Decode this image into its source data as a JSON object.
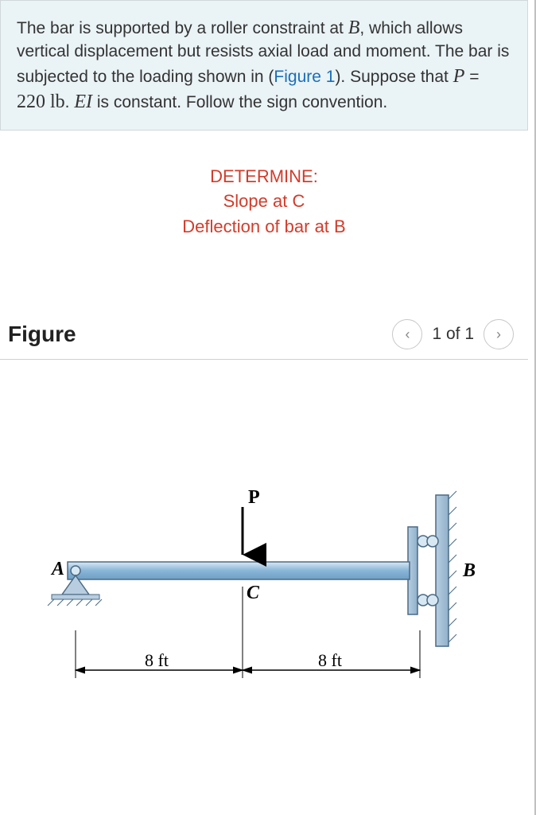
{
  "problem": {
    "text_1": "The bar is supported by a roller constraint at ",
    "var_B": "B",
    "text_2": ", which allows vertical displacement but resists axial load and moment. The bar is subjected to the loading shown in (",
    "fig_link": "Figure 1",
    "text_3": "). Suppose that ",
    "var_P": "P",
    "text_4": " = ",
    "P_value": "220 lb",
    "text_5": ". ",
    "var_EI": "EI",
    "text_6": " is constant. Follow the sign convention."
  },
  "determine": {
    "heading": "DETERMINE:",
    "line1": "Slope at C",
    "line2": "Deflection of bar at B"
  },
  "figure_header": {
    "title": "Figure",
    "prev": "‹",
    "page_text": "1 of 1",
    "next": "›"
  },
  "diagram": {
    "label_A": "A",
    "label_B": "B",
    "label_C": "C",
    "label_P": "P",
    "dim_left": "8 ft",
    "dim_right": "8 ft"
  }
}
